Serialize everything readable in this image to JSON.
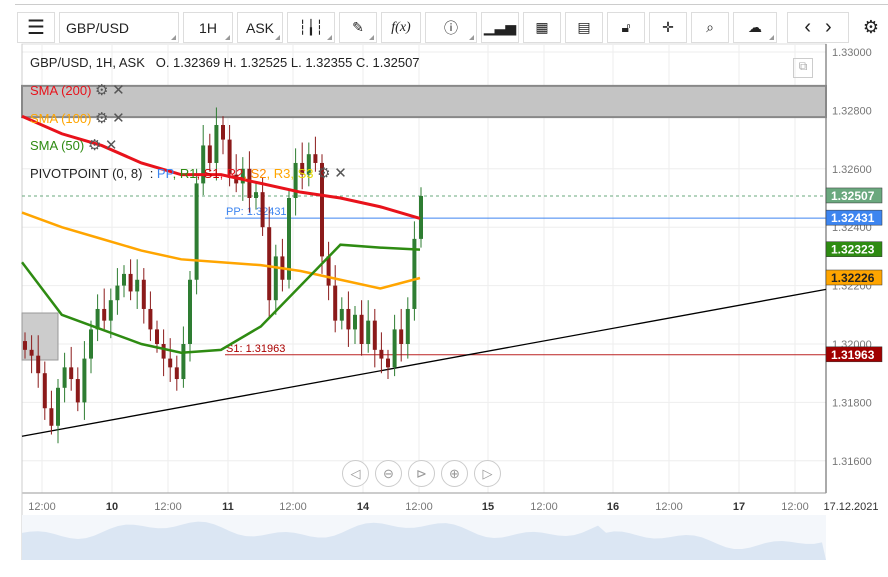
{
  "toolbar": {
    "menu_icon": "hamburger-icon",
    "symbol": "GBP/USD",
    "timeframe": "1H",
    "price_type": "ASK",
    "buttons": [
      "candlestick-icon",
      "pencil-icon",
      "function-icon",
      "info-icon",
      "bar-chart-icon",
      "calendar-icon",
      "calculator-icon",
      "lock-icon",
      "crosshair-icon",
      "zoom-icon",
      "cloud-upload-icon",
      "chevron-left-icon",
      "chevron-right-icon",
      "gear-icon"
    ],
    "fx_label": "f(x)"
  },
  "header": {
    "title": "GBP/USD, 1H, ASK",
    "ohlc": "O. 1.32369 H. 1.32525 L. 1.32355 C. 1.32507"
  },
  "indicators": [
    {
      "label": "SMA (200)",
      "color": "#e8121b"
    },
    {
      "label": "SMA (100)",
      "color": "#ffa500"
    },
    {
      "label": "SMA (50)",
      "color": "#2e8b12"
    }
  ],
  "pivot": {
    "label": "PIVOTPOINT (0, 8)",
    "sep": ":",
    "items": [
      {
        "t": "PP",
        "c": "#3d85f0"
      },
      {
        "t": "R1",
        "c": "#2e8b12"
      },
      {
        "t": "S1",
        "c": "#c00"
      },
      {
        "t": "R2",
        "c": "#e8121b"
      },
      {
        "t": "S2",
        "c": "#ff8c00"
      },
      {
        "t": "R3",
        "c": "#ffa500"
      },
      {
        "t": "S3",
        "c": "#e5d800"
      }
    ]
  },
  "chart_data": {
    "type": "candlestick",
    "y_ticks": [
      "1.33000",
      "1.32800",
      "1.32600",
      "1.32400",
      "1.32200",
      "1.32000",
      "1.31800",
      "1.31600"
    ],
    "ylim": [
      1.3153,
      1.3308
    ],
    "x_ticks": [
      "12:00",
      "10",
      "12:00",
      "11",
      "12:00",
      "14",
      "12:00",
      "15",
      "12:00",
      "16",
      "12:00",
      "17",
      "12:00",
      "17.12.2021"
    ],
    "closes": [
      1.3198,
      1.3196,
      1.319,
      1.3178,
      1.3172,
      1.3185,
      1.3192,
      1.3188,
      1.318,
      1.3195,
      1.3205,
      1.3212,
      1.3208,
      1.3215,
      1.322,
      1.3224,
      1.3218,
      1.3222,
      1.3212,
      1.3205,
      1.32,
      1.3195,
      1.3192,
      1.3188,
      1.32,
      1.3222,
      1.3255,
      1.3268,
      1.3262,
      1.3275,
      1.327,
      1.3258,
      1.3255,
      1.326,
      1.325,
      1.3252,
      1.324,
      1.3215,
      1.323,
      1.3222,
      1.325,
      1.3262,
      1.3258,
      1.3265,
      1.3262,
      1.323,
      1.322,
      1.3208,
      1.3212,
      1.3205,
      1.321,
      1.32,
      1.3208,
      1.3198,
      1.3195,
      1.3192,
      1.3205,
      1.32,
      1.3212,
      1.3236,
      1.32507
    ],
    "sma200": [
      1.3278,
      1.3272,
      1.3268,
      1.3262,
      1.3258,
      1.3258,
      1.3255,
      1.3252,
      1.325,
      1.3247,
      1.3243
    ],
    "sma100": [
      1.3245,
      1.324,
      1.3236,
      1.3232,
      1.3229,
      1.3228,
      1.3227,
      1.3225,
      1.3222,
      1.3219,
      1.32226
    ],
    "sma50": [
      1.3228,
      1.321,
      1.3205,
      1.32,
      1.3197,
      1.3198,
      1.3206,
      1.322,
      1.3234,
      1.3233,
      1.32323
    ],
    "pp": {
      "label": "PP: 1.32431",
      "value": 1.32431
    },
    "s1": {
      "label": "S1: 1.31963",
      "value": 1.31963
    },
    "trendline": [
      1.31684,
      1.32187
    ],
    "rect": [
      1.32884,
      1.32777
    ],
    "price_tags": [
      {
        "v": "1.32507",
        "c": "#6aa87e"
      },
      {
        "v": "1.32431",
        "c": "#3d85f0"
      },
      {
        "v": "1.32323",
        "c": "#2e8b12"
      },
      {
        "v": "1.32226",
        "c": "#ffa500",
        "fg": "#222"
      },
      {
        "v": "1.31963",
        "c": "#a00000"
      }
    ]
  }
}
